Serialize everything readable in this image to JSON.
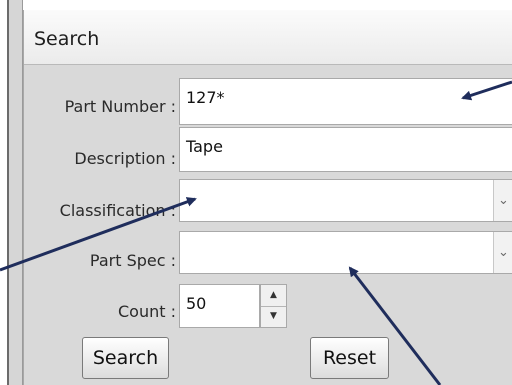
{
  "panel": {
    "title": "Search"
  },
  "form": {
    "part_number": {
      "label": "Part Number :",
      "value": "127*"
    },
    "description": {
      "label": "Description :",
      "value": "Tape"
    },
    "classification": {
      "label": "Classification :",
      "value": ""
    },
    "part_spec": {
      "label": "Part Spec :",
      "value": ""
    },
    "count": {
      "label": "Count :",
      "value": "50"
    }
  },
  "buttons": {
    "search": "Search",
    "reset": "Reset"
  },
  "colors": {
    "arrow": "#1f2d5c",
    "panel_bg": "#d9d9d9"
  }
}
